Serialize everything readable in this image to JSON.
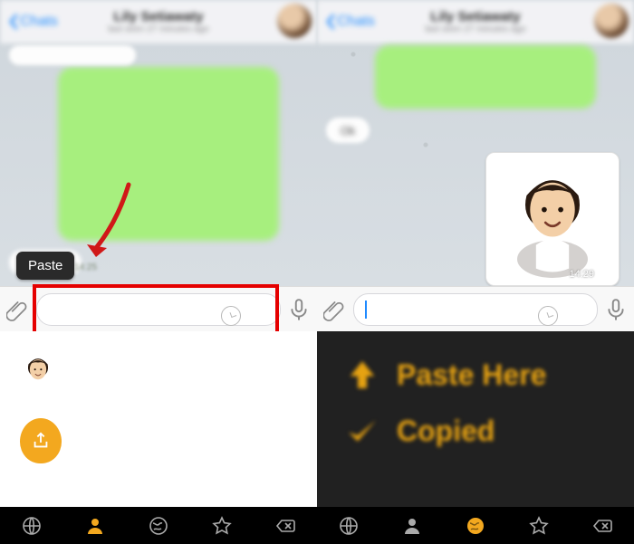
{
  "left": {
    "nav": {
      "back": "Chats",
      "contactName": "Lily Setiawaty",
      "contactSub": "last seen 27 minutes ago"
    },
    "popover": "Paste",
    "time1": "14:25"
  },
  "right": {
    "nav": {
      "back": "Chats",
      "contactName": "Lily Setiawaty",
      "contactSub": "last seen 27 minutes ago"
    },
    "reply": "Ok",
    "stickerTime": "14:29",
    "panel": {
      "paste": "Paste Here",
      "copied": "Copied"
    }
  },
  "input": {
    "placeholder": ""
  },
  "icons": {
    "attach": "attachment-icon",
    "clock": "timer-icon",
    "mic": "microphone-icon",
    "globe": "globe-icon",
    "person": "person-icon",
    "earth": "earth-icon",
    "star": "star-icon",
    "backspace": "backspace-icon",
    "share": "share-icon",
    "arrowUp": "arrow-up-icon",
    "check": "check-icon",
    "chevronLeft": "chevron-left-icon",
    "pointer": "red-pointer-arrow"
  }
}
